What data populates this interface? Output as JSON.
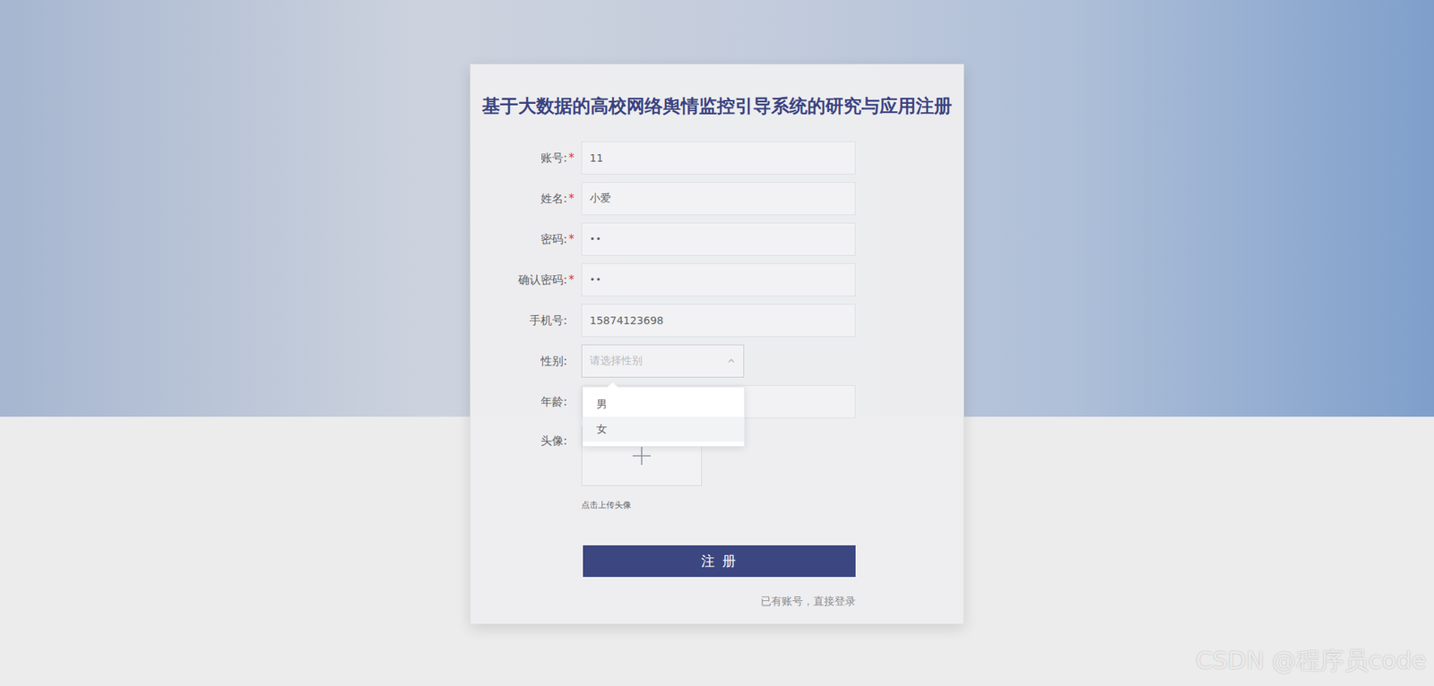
{
  "title": "基于大数据的高校网络舆情监控引导系统的研究与应用注册",
  "required_mark": "*",
  "fields": [
    {
      "label": "账号:",
      "required": true,
      "kind": "input",
      "value": "11",
      "placeholder": ""
    },
    {
      "label": "姓名:",
      "required": true,
      "kind": "input",
      "value": "小爱",
      "placeholder": ""
    },
    {
      "label": "密码:",
      "required": true,
      "kind": "password",
      "value": "••",
      "placeholder": ""
    },
    {
      "label": "确认密码:",
      "required": true,
      "kind": "password",
      "value": "••",
      "placeholder": ""
    },
    {
      "label": "手机号:",
      "required": false,
      "kind": "input",
      "value": "15874123698",
      "placeholder": ""
    },
    {
      "label": "性别:",
      "required": false,
      "kind": "select",
      "value": "",
      "placeholder": "请选择性别",
      "expanded": true,
      "options": [
        {
          "label": "男",
          "hovered": false
        },
        {
          "label": "女",
          "hovered": true
        }
      ]
    },
    {
      "label": "年龄:",
      "required": false,
      "kind": "input",
      "value": "",
      "placeholder": ""
    },
    {
      "label": "头像:",
      "required": false,
      "kind": "upload",
      "value": "",
      "placeholder": "",
      "hint": "点击上传头像"
    }
  ],
  "submit": "注 册",
  "login_link": "已有账号，直接登录",
  "watermark": "CSDN @程序员code"
}
